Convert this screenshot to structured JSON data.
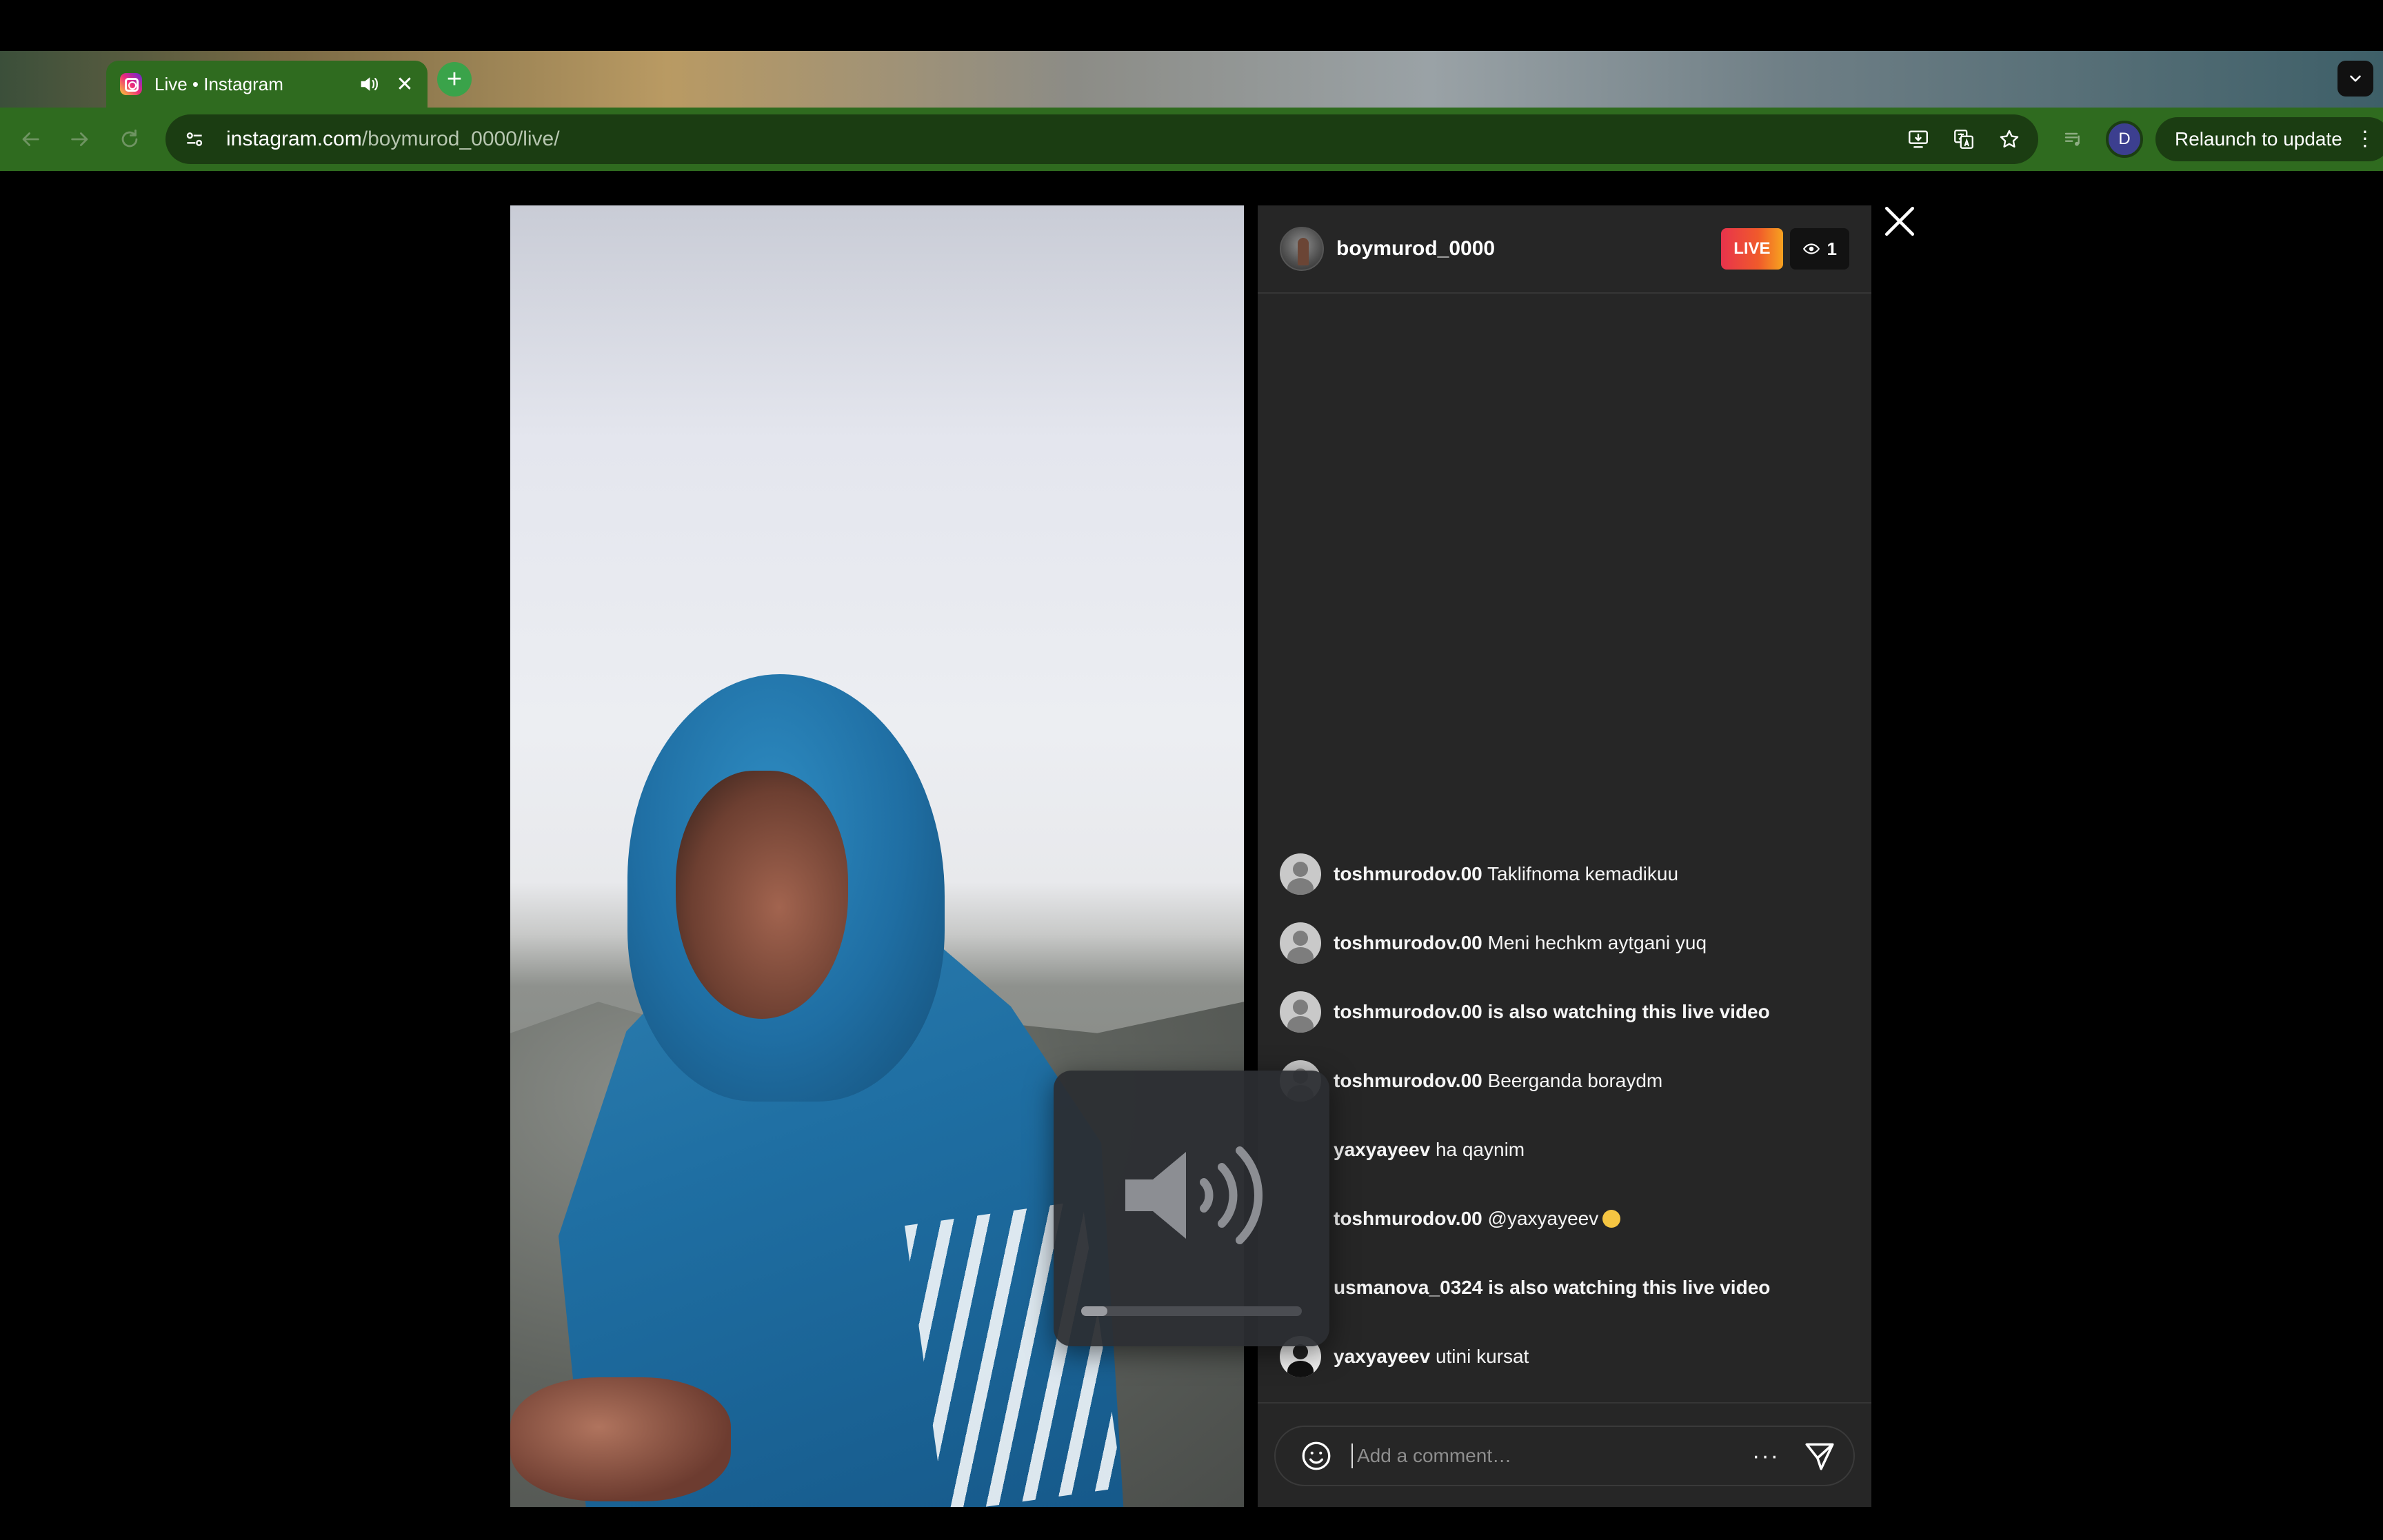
{
  "browser": {
    "tab_title": "Live • Instagram",
    "url_domain": "instagram.com",
    "url_path": "/boymurod_0000/live/",
    "profile_initial": "D",
    "relaunch_label": "Relaunch to update",
    "new_tab_label": "+"
  },
  "live": {
    "username": "boymurod_0000",
    "live_badge": "LIVE",
    "viewer_count": "1",
    "volume_level": 0.12,
    "comments": [
      {
        "user": "toshmurodov.00",
        "text": "Taklifnoma kemadikuu",
        "avatar": "default"
      },
      {
        "user": "toshmurodov.00",
        "text": "Meni hechkm aytgani yuq",
        "avatar": "default"
      },
      {
        "user": "toshmurodov.00 is also watching this live video",
        "text": "",
        "avatar": "default"
      },
      {
        "user": "toshmurodov.00",
        "text": "Beerganda boraydm",
        "avatar": "default"
      },
      {
        "user": "yaxyayeev",
        "text": "ha qaynim",
        "avatar": "none"
      },
      {
        "user": "toshmurodov.00",
        "text": "@yaxyayeev",
        "avatar": "none",
        "emoji": true
      },
      {
        "user": "usmanova_0324 is also watching this live video",
        "text": "",
        "avatar": "none"
      },
      {
        "user": "yaxyayeev",
        "text": "utini kursat",
        "avatar": "dark"
      }
    ],
    "comment_placeholder": "Add a comment…",
    "more_label": "···"
  }
}
